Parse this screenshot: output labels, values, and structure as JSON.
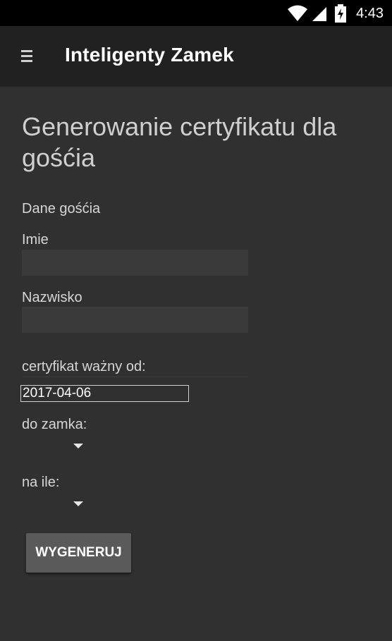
{
  "status_bar": {
    "time": "4:43",
    "icons": [
      "wifi-icon",
      "cell-signal-icon",
      "battery-charging-icon"
    ]
  },
  "app_bar": {
    "menu_icon": "hamburger-menu-icon",
    "title": "Inteligenty Zamek"
  },
  "form": {
    "heading": "Generowanie certyfikatu dla gośćia",
    "guest_section_label": "Dane gośćia",
    "first_name_label": "Imie",
    "first_name_value": "",
    "last_name_label": "Nazwisko",
    "last_name_value": "",
    "valid_from_label": "certyfikat ważny od:",
    "valid_from_value": "2017-04-06",
    "lock_label": "do zamka:",
    "lock_value": "",
    "duration_label": "na ile:",
    "duration_value": "",
    "generate_button": "WYGENERUJ"
  },
  "colors": {
    "background": "#303030",
    "app_bar": "#212121",
    "status_bar": "#000000",
    "button": "#5a5a5a"
  }
}
